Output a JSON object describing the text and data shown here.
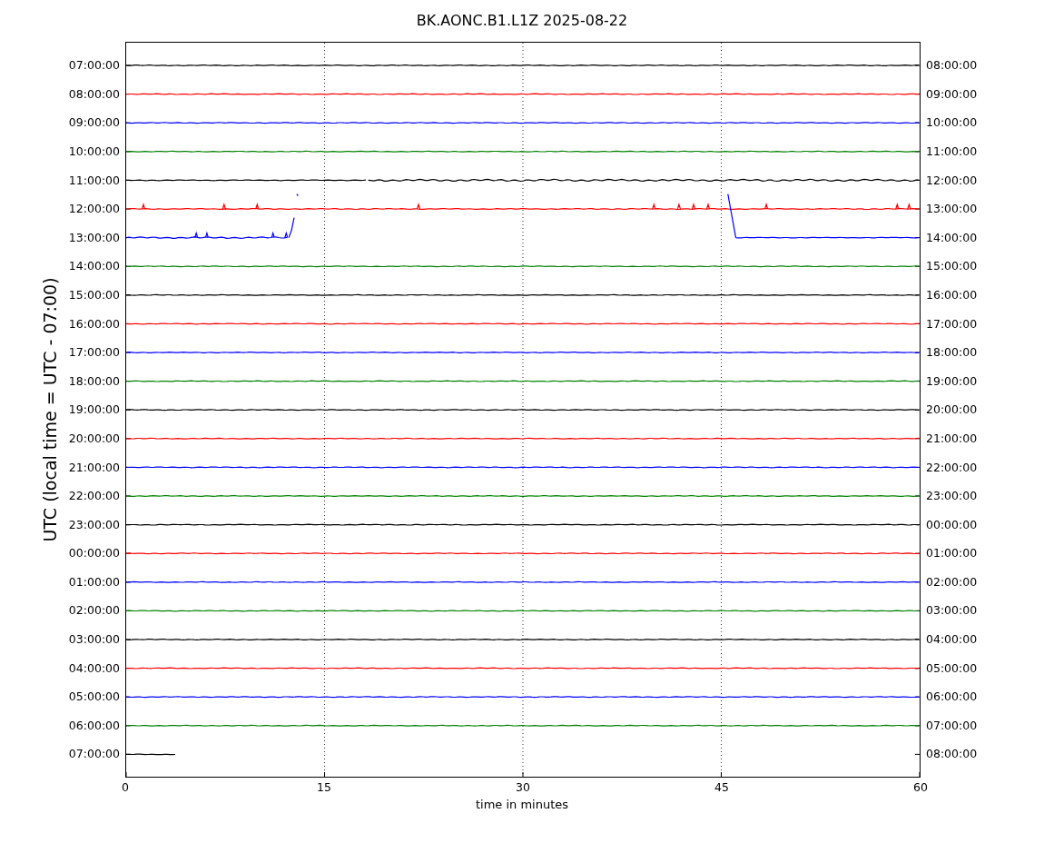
{
  "title": "BK.AONC.B1.L1Z 2025-08-22",
  "ylabel": "UTC (local time = UTC - 07:00)",
  "xlabel": "time in minutes",
  "xticks": [
    "0",
    "15",
    "30",
    "45",
    "60"
  ],
  "traces": [
    {
      "left": "07:00:00",
      "right": "08:00:00",
      "color": "#000000",
      "kind": "flat"
    },
    {
      "left": "08:00:00",
      "right": "09:00:00",
      "color": "#ff0000",
      "kind": "flat"
    },
    {
      "left": "09:00:00",
      "right": "10:00:00",
      "color": "#0000ff",
      "kind": "flat"
    },
    {
      "left": "10:00:00",
      "right": "11:00:00",
      "color": "#008000",
      "kind": "flat"
    },
    {
      "left": "11:00:00",
      "right": "12:00:00",
      "color": "#000000",
      "kind": "noisy"
    },
    {
      "left": "12:00:00",
      "right": "13:00:00",
      "color": "#ff0000",
      "kind": "spiky"
    },
    {
      "left": "13:00:00",
      "right": "14:00:00",
      "color": "#0000ff",
      "kind": "gap"
    },
    {
      "left": "14:00:00",
      "right": "15:00:00",
      "color": "#008000",
      "kind": "flat"
    },
    {
      "left": "15:00:00",
      "right": "16:00:00",
      "color": "#000000",
      "kind": "flat"
    },
    {
      "left": "16:00:00",
      "right": "17:00:00",
      "color": "#ff0000",
      "kind": "flat"
    },
    {
      "left": "17:00:00",
      "right": "18:00:00",
      "color": "#0000ff",
      "kind": "flat"
    },
    {
      "left": "18:00:00",
      "right": "19:00:00",
      "color": "#008000",
      "kind": "flat"
    },
    {
      "left": "19:00:00",
      "right": "20:00:00",
      "color": "#000000",
      "kind": "flat"
    },
    {
      "left": "20:00:00",
      "right": "21:00:00",
      "color": "#ff0000",
      "kind": "flat"
    },
    {
      "left": "21:00:00",
      "right": "22:00:00",
      "color": "#0000ff",
      "kind": "flat"
    },
    {
      "left": "22:00:00",
      "right": "23:00:00",
      "color": "#008000",
      "kind": "flat"
    },
    {
      "left": "23:00:00",
      "right": "00:00:00",
      "color": "#000000",
      "kind": "flat"
    },
    {
      "left": "00:00:00",
      "right": "01:00:00",
      "color": "#ff0000",
      "kind": "flat"
    },
    {
      "left": "01:00:00",
      "right": "02:00:00",
      "color": "#0000ff",
      "kind": "flat"
    },
    {
      "left": "02:00:00",
      "right": "03:00:00",
      "color": "#008000",
      "kind": "flat"
    },
    {
      "left": "03:00:00",
      "right": "04:00:00",
      "color": "#000000",
      "kind": "flat"
    },
    {
      "left": "04:00:00",
      "right": "05:00:00",
      "color": "#ff0000",
      "kind": "flat"
    },
    {
      "left": "05:00:00",
      "right": "06:00:00",
      "color": "#0000ff",
      "kind": "flat"
    },
    {
      "left": "06:00:00",
      "right": "07:00:00",
      "color": "#008000",
      "kind": "flat"
    },
    {
      "left": "07:00:00",
      "right": "08:00:00",
      "color": "#000000",
      "kind": "partial"
    }
  ]
}
